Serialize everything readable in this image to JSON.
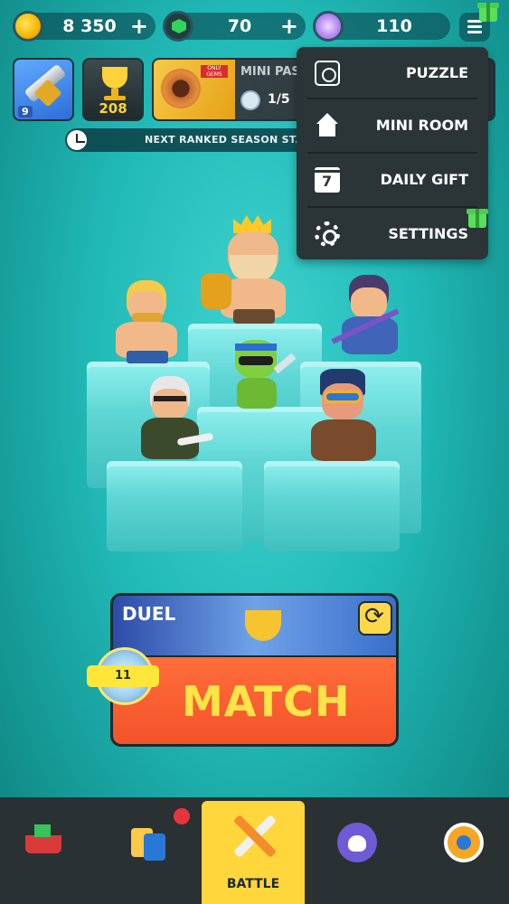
{
  "currencies": {
    "coins": "8 350",
    "gems": "70",
    "stars": "110",
    "plus": "+"
  },
  "cards": {
    "level": "9",
    "trophies": "208",
    "pass_title": "MINI PASS",
    "pass_tag": "ONLY GEMS",
    "pass_progress": "1/5"
  },
  "season_banner": "NEXT RANKED SEASON STARTS IN",
  "menu": {
    "items": [
      {
        "label": "PUZZLE",
        "icon": "puzzle-icon"
      },
      {
        "label": "MINI ROOM",
        "icon": "house-icon"
      },
      {
        "label": "DAILY GIFT",
        "icon": "calendar-icon"
      },
      {
        "label": "SETTINGS",
        "icon": "gear-icon"
      }
    ]
  },
  "duel": {
    "title": "DUEL",
    "match_label": "MATCH",
    "rank": "11"
  },
  "nav": {
    "battle_label": "BATTLE",
    "items": [
      "shop-icon",
      "collection-icon",
      "battle-icon",
      "clan-icon",
      "events-icon"
    ]
  },
  "colors": {
    "background": "#21b9b6",
    "accent_yellow": "#ffd63c",
    "match_orange": "#f3532a",
    "menu_bg": "#2b3538",
    "nav_bg": "#2a3133"
  }
}
